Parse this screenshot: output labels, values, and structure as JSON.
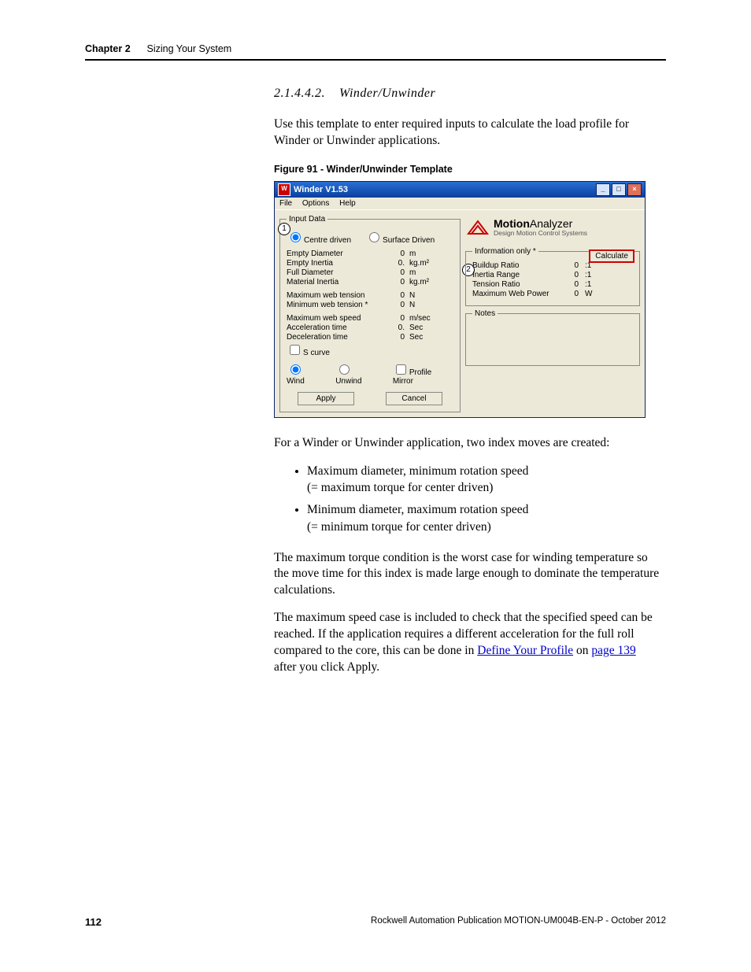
{
  "header": {
    "chapter": "Chapter 2",
    "title": "Sizing Your System"
  },
  "section": {
    "number": "2.1.4.4.2.",
    "title": "Winder/Unwinder"
  },
  "intro": "Use this template to enter required inputs to calculate the load profile for Winder or Unwinder applications.",
  "figure_caption": "Figure 91 - Winder/Unwinder Template",
  "window": {
    "title": "Winder V1.53",
    "menus": [
      "File",
      "Options",
      "Help"
    ],
    "input_group": "Input Data",
    "drive_options": {
      "centre": "Centre driven",
      "surface": "Surface Driven"
    },
    "rows": [
      {
        "label": "Empty Diameter",
        "value": "0",
        "unit": "m"
      },
      {
        "label": "Empty Inertia",
        "value": "0.",
        "unit": "kg.m²"
      },
      {
        "label": "Full Diameter",
        "value": "0",
        "unit": "m"
      },
      {
        "label": "Material Inertia",
        "value": "0",
        "unit": "kg.m²"
      },
      {
        "label": "Maximum web tension",
        "value": "0",
        "unit": "N"
      },
      {
        "label": "Minimum web tension *",
        "value": "0",
        "unit": "N"
      },
      {
        "label": "Maximum web speed",
        "value": "0",
        "unit": "m/sec"
      },
      {
        "label": "Acceleration time",
        "value": "0.",
        "unit": "Sec"
      },
      {
        "label": "Deceleration time",
        "value": "0",
        "unit": "Sec"
      }
    ],
    "scurve": "S curve",
    "wind_opts": {
      "wind": "Wind",
      "unwind": "Unwind",
      "mirror": "Profile Mirror"
    },
    "buttons": {
      "apply": "Apply",
      "cancel": "Cancel"
    },
    "logo": {
      "line1a": "Motion",
      "line1b": "Analyzer",
      "line2": "Design Motion Control Systems"
    },
    "info_group": "Information only *",
    "calculate": "Calculate",
    "info_rows": [
      {
        "label": "Buildup Ratio",
        "v1": "0",
        "v2": ":1"
      },
      {
        "label": "Inertia Range",
        "v1": "0",
        "v2": ":1"
      },
      {
        "label": "Tension Ratio",
        "v1": "0",
        "v2": ":1"
      },
      {
        "label": "Maximum Web Power",
        "v1": "0",
        "v2": "W"
      }
    ],
    "notes_group": "Notes"
  },
  "para_after_fig": "For a Winder or Unwinder application, two index moves are created:",
  "bullets": [
    {
      "l1": "Maximum diameter, minimum rotation speed",
      "l2": "(= maximum torque for center driven)"
    },
    {
      "l1": "Minimum diameter, maximum rotation speed",
      "l2": "(= minimum torque for center driven)"
    }
  ],
  "para_torque": "The maximum torque condition is the worst case for winding temperature so the move time for this index is made large enough to dominate the temperature calculations.",
  "para_speed_a": "The maximum speed case is included to check that the specified speed can be reached. If the application requires a different acceleration for the full roll compared to the core, this can be done in ",
  "link1": "Define Your Profile",
  "para_speed_b": " on ",
  "link2": "page 139",
  "para_speed_c": " after you click Apply.",
  "footer": {
    "page": "112",
    "pub": "Rockwell Automation Publication MOTION-UM004B-EN-P - October 2012"
  }
}
